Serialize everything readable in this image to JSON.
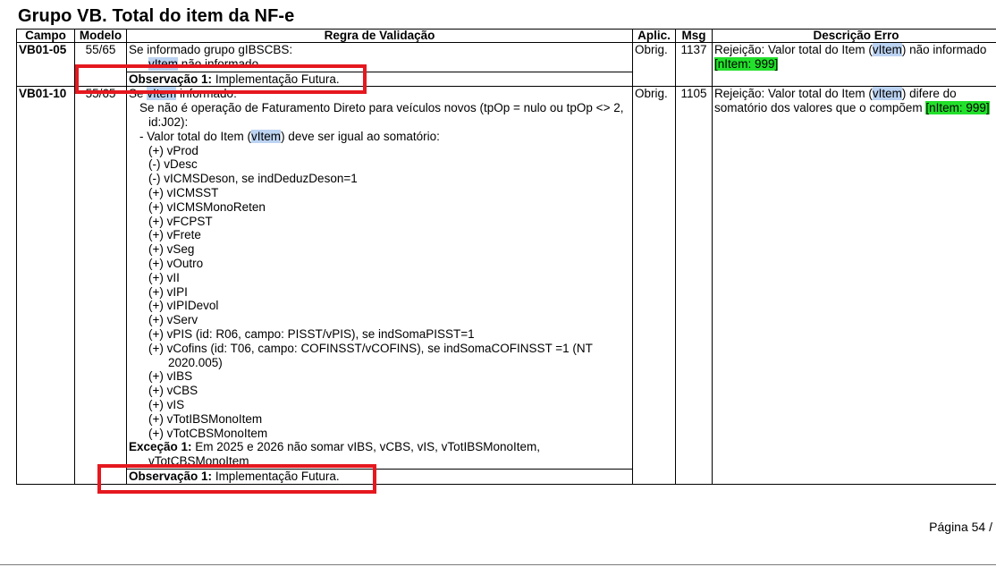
{
  "title": "Grupo VB. Total do item da NF-e",
  "headers": {
    "campo": "Campo",
    "modelo": "Modelo",
    "regra": "Regra de Validação",
    "aplic": "Aplic.",
    "msg": "Msg",
    "descricao": "Descrição Erro"
  },
  "rows": [
    {
      "campo": "VB01-05",
      "modelo": "55/65",
      "regra": {
        "l1": "Se informado grupo gIBSCBS:",
        "l2_field": "vItem",
        "l2_rest": " não informado",
        "obs_label": "Observação 1:",
        "obs_text": " Implementação Futura."
      },
      "aplic": "Obrig.",
      "msg": "1137",
      "descricao": {
        "pre": "Rejeição: Valor total do Item (",
        "field": "vItem",
        "post": ") não informado ",
        "tag": "[nItem: 999]"
      }
    },
    {
      "campo": "VB01-10",
      "modelo": "55/65",
      "regra": {
        "l1_pre": "Se ",
        "l1_field": "vItem",
        "l1_post": " informado:",
        "l2": "Se não é operação de Faturamento Direto para veículos novos (tpOp = nulo ou tpOp <> 2,",
        "l2b": "id:J02):",
        "l3_pre": "- Valor total do Item (",
        "l3_field": "vItem",
        "l3_post": ") deve ser igual ao somatório:",
        "items": [
          "(+) vProd",
          "(-) vDesc",
          "(-) vICMSDeson, se indDeduzDeson=1",
          "(+) vICMSST",
          "(+) vICMSMonoReten",
          "(+) vFCPST",
          "(+) vFrete",
          "(+) vSeg",
          "(+) vOutro",
          "(+) vII",
          "(+) vIPI",
          "(+) vIPIDevol",
          "(+) vServ",
          "(+) vPIS (id: R06, campo: PISST/vPIS), se indSomaPISST=1",
          "(+) vCofins (id: T06, campo: COFINSST/vCOFINS), se indSomaCOFINSST =1 (NT"
        ],
        "cofins_wrap": "2020.005)",
        "items2": [
          "(+) vIBS",
          "(+) vCBS",
          "(+) vIS",
          "(+) vTotIBSMonoItem",
          "(+) vTotCBSMonoItem"
        ],
        "exc_label": "Exceção 1:",
        "exc_text": " Em 2025 e 2026 não somar vIBS, vCBS, vIS, vTotIBSMonoItem,",
        "exc_wrap": "vTotCBSMonoItem",
        "obs_label": "Observação 1:",
        "obs_text": " Implementação Futura."
      },
      "aplic": "Obrig.",
      "msg": "1105",
      "descricao": {
        "pre": "Rejeição: Valor total do Item (",
        "field": "vItem",
        "post": ") difere do somatório dos valores que o compõem ",
        "tag": "[nItem: 999]"
      }
    }
  ],
  "footer": "Página 54 /",
  "colors": {
    "highlight_field": "#bcd3f2",
    "highlight_tag": "#22e02b",
    "annotation_box": "#e5181f"
  }
}
